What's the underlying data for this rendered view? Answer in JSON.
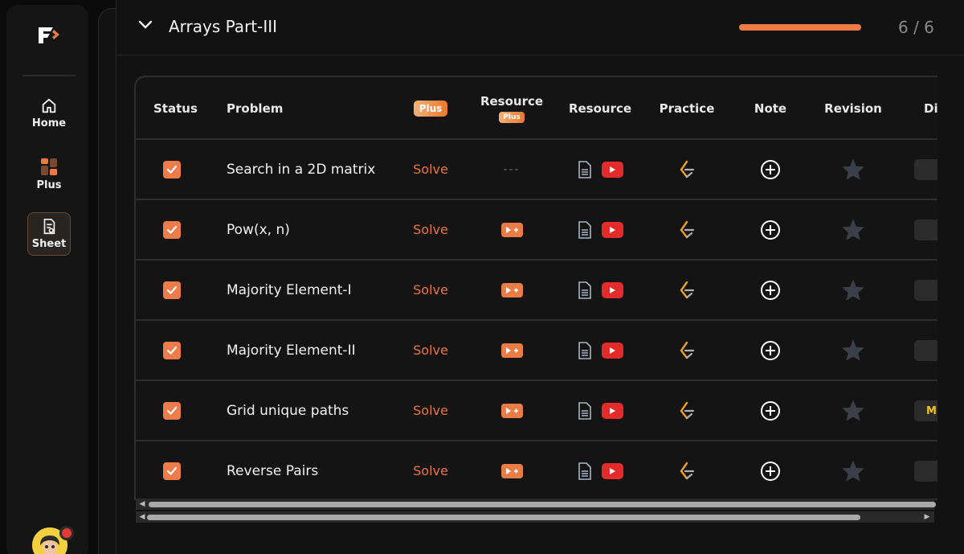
{
  "sidebar": {
    "items": [
      {
        "label": "Home",
        "icon": "home-icon"
      },
      {
        "label": "Plus",
        "icon": "grid-icon"
      },
      {
        "label": "Sheet",
        "icon": "sheet-icon",
        "active": true
      }
    ]
  },
  "section": {
    "title": "Arrays Part-III",
    "progress_text": "6 / 6",
    "progress_fraction": 1.0
  },
  "table": {
    "headers": {
      "status": "Status",
      "problem": "Problem",
      "plus_badge": "Plus",
      "resource_plus": "Resource",
      "resource_plus_badge": "Plus",
      "resource": "Resource",
      "practice": "Practice",
      "note": "Note",
      "revision": "Revision",
      "difficulty": "Di"
    },
    "rows": [
      {
        "problem": "Search in a 2D matrix",
        "solve": "Solve",
        "resource_plus": "---",
        "difficulty": ""
      },
      {
        "problem": "Pow(x, n)",
        "solve": "Solve",
        "resource_plus": "",
        "difficulty": ""
      },
      {
        "problem": "Majority Element-I",
        "solve": "Solve",
        "resource_plus": "",
        "difficulty": ""
      },
      {
        "problem": "Majority Element-II",
        "solve": "Solve",
        "resource_plus": "",
        "difficulty": ""
      },
      {
        "problem": "Grid unique paths",
        "solve": "Solve",
        "resource_plus": "",
        "difficulty": "M"
      },
      {
        "problem": "Reverse Pairs",
        "solve": "Solve",
        "resource_plus": "",
        "difficulty": ""
      }
    ]
  },
  "colors": {
    "accent": "#ee7b4a",
    "youtube": "#e32b2b",
    "difficulty_medium": "#f0c419"
  }
}
